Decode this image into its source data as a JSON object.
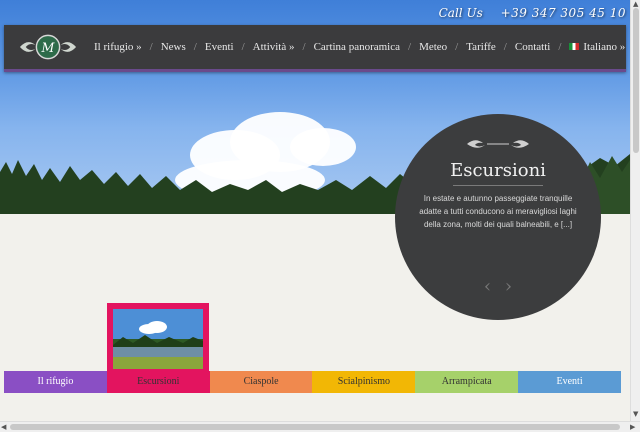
{
  "header": {
    "call_label": "Call Us",
    "phone": "+39 347 305 45 10"
  },
  "logo": {
    "initials": "M",
    "icon": "lodge-logo"
  },
  "nav": {
    "items": [
      {
        "label": "Il rifugio »"
      },
      {
        "label": "News"
      },
      {
        "label": "Eventi"
      },
      {
        "label": "Attività »"
      },
      {
        "label": "Cartina panoramica"
      },
      {
        "label": "Meteo"
      },
      {
        "label": "Tariffe"
      },
      {
        "label": "Contatti"
      },
      {
        "label": "Italiano »",
        "icon": "italian-flag-icon"
      }
    ],
    "separator": "/"
  },
  "feature": {
    "title": "Escursioni",
    "description": "In estate e autunno passeggiate tranquille adatte a tutti conducono ai meravigliosi laghi della zona, molti dei quali balneabili, e [...]",
    "prev_icon": "‹",
    "next_icon": "›"
  },
  "tabs": [
    {
      "label": "Il rifugio",
      "color": "#8a4fc4",
      "text_color": "#ffffff"
    },
    {
      "label": "Escursioni",
      "color": "#e3145f",
      "text_color": "#333333",
      "active": true
    },
    {
      "label": "Ciaspole",
      "color": "#f0894e",
      "text_color": "#333333"
    },
    {
      "label": "Scialpinismo",
      "color": "#f2b705",
      "text_color": "#333333"
    },
    {
      "label": "Arrampicata",
      "color": "#a6d16a",
      "text_color": "#333333"
    },
    {
      "label": "Eventi",
      "color": "#5b9bd4",
      "text_color": "#ffffff"
    }
  ]
}
